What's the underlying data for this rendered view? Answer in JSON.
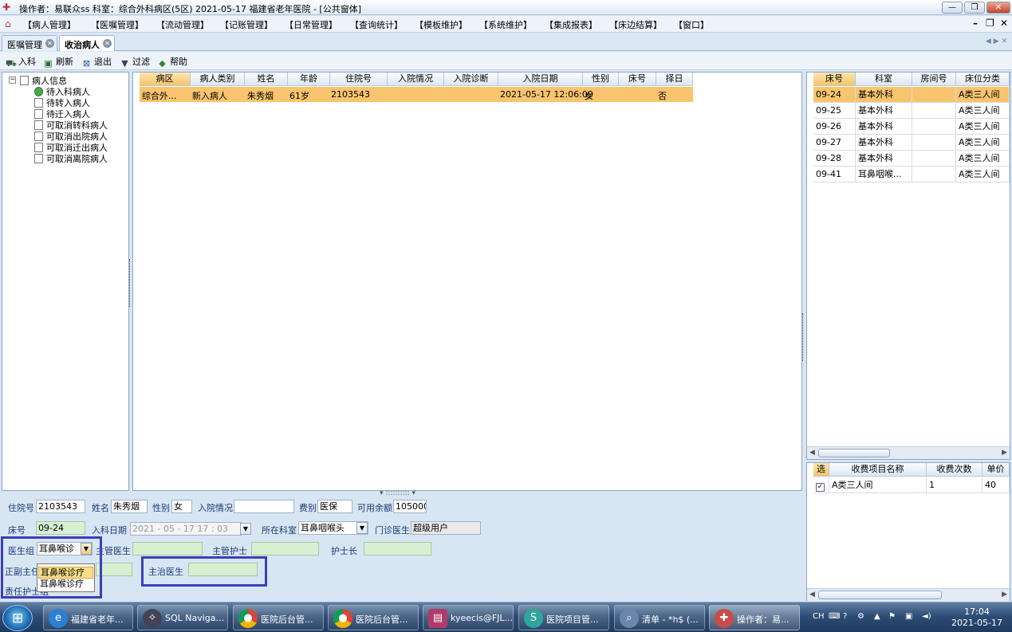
{
  "window": {
    "title": "操作者：易联众ss  科室：综合外科病区(5区)  2021-05-17  福建省老年医院 - [公共窗体]",
    "controls": {
      "minimize": "—",
      "restore": "❐",
      "close": "✕"
    }
  },
  "menu": {
    "items": [
      "【病人管理】",
      "【医嘱管理】",
      "【流动管理】",
      "【记账管理】",
      "【日常管理】",
      "【查询统计】",
      "【模板维护】",
      "【系统维护】",
      "【集成报表】",
      "【床边结算】",
      "【窗口】"
    ],
    "mdi_controls": {
      "minimize": "–",
      "restore": "❐",
      "close": "✕"
    }
  },
  "tabs": [
    {
      "label": "医嘱管理",
      "active": false
    },
    {
      "label": "收治病人",
      "active": true
    }
  ],
  "toolbar": [
    {
      "label": "入科",
      "icon": "admit-icon"
    },
    {
      "label": "刷新",
      "icon": "refresh-icon"
    },
    {
      "label": "退出",
      "icon": "exit-icon"
    },
    {
      "label": "过滤",
      "icon": "filter-icon"
    },
    {
      "label": "帮助",
      "icon": "help-icon"
    }
  ],
  "tree": {
    "root": "病人信息",
    "children": [
      "待入科病人",
      "待转入病人",
      "待迁入病人",
      "可取消转科病人",
      "可取消出院病人",
      "可取消迁出病人",
      "可取消离院病人"
    ]
  },
  "patient_grid": {
    "columns": [
      "病区",
      "病人类别",
      "姓名",
      "年龄",
      "住院号",
      "入院情况",
      "入院诊断",
      "入院日期",
      "性别",
      "床号",
      "择日"
    ],
    "rows": [
      [
        "综合外...",
        "新入病人",
        "朱秀烟",
        "61岁",
        "2103543",
        "",
        "",
        "2021-05-17 12:06:00",
        "女",
        "",
        "否"
      ]
    ]
  },
  "bed_grid": {
    "columns": [
      "床号",
      "科室",
      "房间号",
      "床位分类"
    ],
    "rows": [
      [
        "09-24",
        "基本外科",
        "",
        "A类三人间"
      ],
      [
        "09-25",
        "基本外科",
        "",
        "A类三人间"
      ],
      [
        "09-26",
        "基本外科",
        "",
        "A类三人间"
      ],
      [
        "09-27",
        "基本外科",
        "",
        "A类三人间"
      ],
      [
        "09-28",
        "基本外科",
        "",
        "A类三人间"
      ],
      [
        "09-41",
        "耳鼻咽喉...",
        "",
        "A类三人间"
      ]
    ]
  },
  "fee_grid": {
    "columns": [
      "选",
      "收费项目名称",
      "收费次数",
      "单价"
    ],
    "rows": [
      {
        "checked": true,
        "name": "A类三人间",
        "count": "1",
        "price": "40"
      }
    ]
  },
  "form": {
    "inpatient_no_label": "住院号",
    "inpatient_no": "2103543",
    "name_label": "姓名",
    "name": "朱秀烟",
    "gender_label": "性别",
    "gender": "女",
    "admission_status_label": "入院情况",
    "admission_status": "",
    "fee_type_label": "费别",
    "fee_type": "医保",
    "balance_label": "可用余额",
    "balance": "105000",
    "bed_label": "床号",
    "bed": "09-24",
    "admit_date_label": "入科日期",
    "admit_date": "2021 - 05 - 17    17 : 03",
    "dept_label": "所在科室",
    "dept": "耳鼻咽喉头",
    "clinic_doctor_label": "门诊医生",
    "clinic_doctor": "超级用户",
    "doctor_group_label": "医生组",
    "doctor_group": "耳鼻喉诊",
    "chief_doctor_label": "主管医生",
    "chief_doctor": "",
    "chief_nurse_label": "主管护士",
    "chief_nurse": "",
    "head_nurse_label": "护士长",
    "head_nurse": "",
    "deputy_chief_label": "正副主任",
    "deputy_chief": "",
    "attending_label": "主治医生",
    "attending": "",
    "resp_nurse_label": "责任护士组",
    "dropdown_options": [
      "耳鼻喉诊疗",
      "耳鼻喉诊疗"
    ]
  },
  "taskbar": {
    "tasks": [
      {
        "label": "福建省老年...",
        "icon": "ie-icon"
      },
      {
        "label": "SQL Naviga...",
        "icon": "sql-navigator-icon"
      },
      {
        "label": "医院后台管...",
        "icon": "chrome-icon"
      },
      {
        "label": "医院后台管...",
        "icon": "chrome-icon"
      },
      {
        "label": "kyeecis@FJL...",
        "icon": "database-icon"
      },
      {
        "label": "医院项目管...",
        "icon": "app-icon"
      },
      {
        "label": "清单 -  *h$ (...",
        "icon": "search-icon"
      },
      {
        "label": "操作者：易...",
        "icon": "his-icon"
      }
    ],
    "ime": "CH",
    "time": "17:04",
    "date": "2021-05-17"
  },
  "colors": {
    "selected_row": "#f8c46e",
    "highlight_box": "#3d3fb8",
    "green_field": "#d7f0d2"
  }
}
